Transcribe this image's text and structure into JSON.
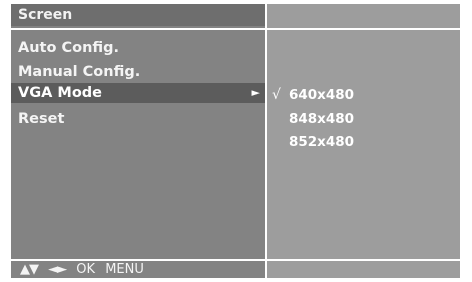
{
  "screen": {
    "title": "Screen"
  },
  "menu": {
    "items": [
      {
        "label": "Auto Config.",
        "selected": false
      },
      {
        "label": "Manual Config.",
        "selected": false
      },
      {
        "label": "VGA Mode",
        "selected": true,
        "arrow": "►"
      },
      {
        "label": "Reset",
        "selected": false
      }
    ]
  },
  "submenu": {
    "check_mark": "√",
    "options": [
      {
        "label": "640x480",
        "checked": true
      },
      {
        "label": "848x480",
        "checked": false
      },
      {
        "label": "852x480",
        "checked": false
      }
    ]
  },
  "footer": {
    "up_down": "▲▼",
    "left_right": "◄►",
    "ok": "OK",
    "menu": "MENU"
  },
  "colors": {
    "panel_left": "#838383",
    "panel_right": "#9d9d9d",
    "selected_row": "#5c5c5c",
    "text": "#ffffff"
  }
}
